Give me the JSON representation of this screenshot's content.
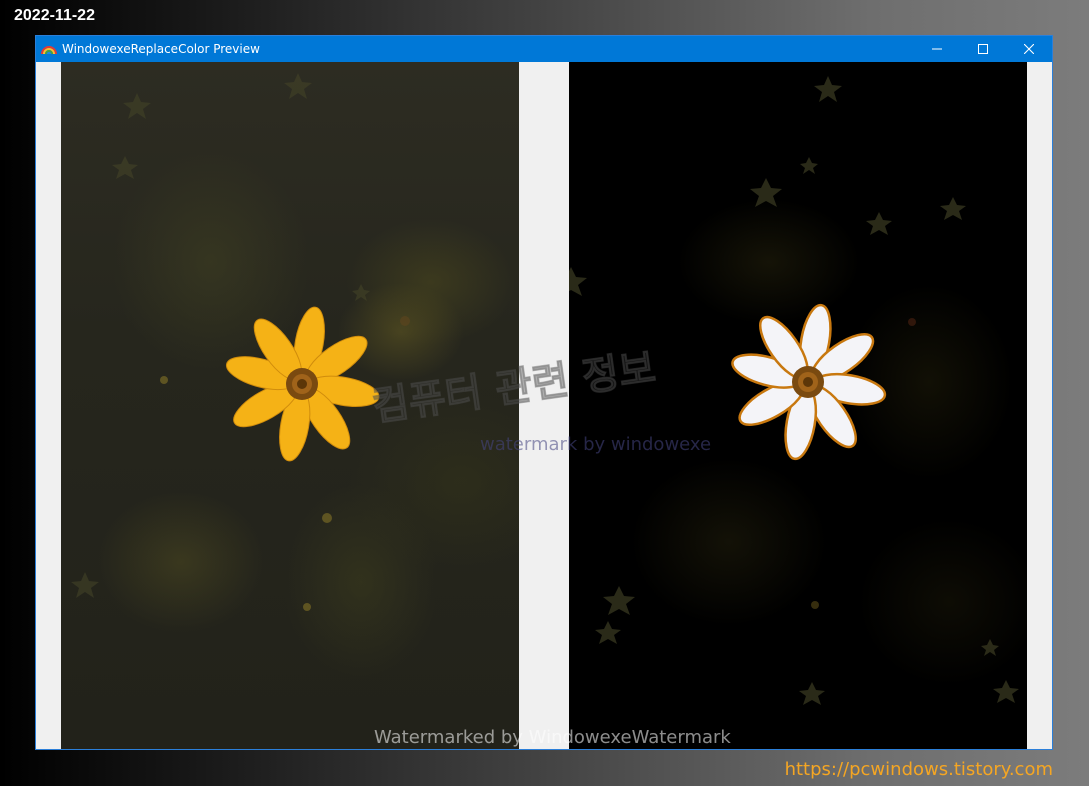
{
  "page": {
    "date": "2022-11-22",
    "url": "https://pcwindows.tistory.com"
  },
  "window": {
    "title": "WindowexeReplaceColor Preview",
    "icon": "rainbow-icon",
    "controls": {
      "minimize": "minimize-icon",
      "maximize": "maximize-icon",
      "close": "close-icon"
    }
  },
  "preview": {
    "left_panel": {
      "image": "yellow-cosmos-flower-photo",
      "petal_color": "#f5b216",
      "center_color": "#7a4a10",
      "background_color": "#26261d"
    },
    "right_panel": {
      "image": "white-cosmos-flower-photo",
      "petal_color": "#f4f4f8",
      "outline_color": "#c8780f",
      "center_color": "#7a4a10",
      "background_color": "#000000"
    }
  },
  "watermarks": {
    "korean": "컴퓨터 관련 정보",
    "sub": "watermark by windowexe",
    "bottom": "Watermarked by WindowexeWatermark",
    "star_icon": "star-icon"
  }
}
